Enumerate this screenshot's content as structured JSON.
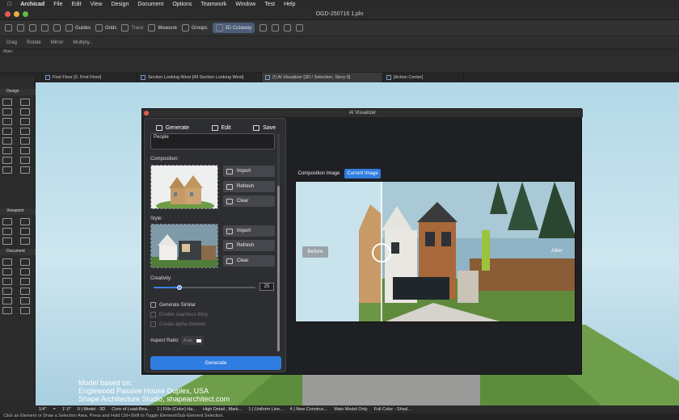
{
  "menubar": {
    "app": "Archicad",
    "items": [
      "File",
      "Edit",
      "View",
      "Design",
      "Document",
      "Options",
      "Teamwork",
      "Window",
      "Test",
      "Help"
    ]
  },
  "window": {
    "title": "OGD-250716 1.pln"
  },
  "toolbar": {
    "guides": "Guides",
    "grids": "Grids",
    "trace": "Trace",
    "measure": "Measure",
    "groups": "Groups",
    "cutaway": "3D Cutaway"
  },
  "edit_toolbar": {
    "drag": "Drag",
    "rotate": "Rotate",
    "mirror": "Mirror",
    "multiply": "Multiply..."
  },
  "main_label": "Main:",
  "tabs": [
    {
      "label": "First Floor [0. First Floor]"
    },
    {
      "label": "Section Looking West [49 Section Looking West]"
    },
    {
      "label": "(!) AI Visualizer [3D / Selection, Story 0]"
    },
    {
      "label": "[Action Center]"
    }
  ],
  "toolbox": {
    "design": "Design",
    "viewpoint": "Viewpoint",
    "document": "Document"
  },
  "ai_window": {
    "title": "AI Visualizer",
    "tabs": {
      "generate": "Generate",
      "edit": "Edit",
      "save": "Save"
    },
    "prompt_text": "People",
    "composition_label": "Composition:",
    "style_label": "Style:",
    "buttons": {
      "import": "Import",
      "refresh": "Refresh",
      "clear": "Clear"
    },
    "creativity_label": "Creativity:",
    "creativity_value": "25",
    "creativity_fraction": 0.25,
    "checkboxes": {
      "generate_similar": "Generate Similar",
      "seamless": "Enable seamless tiling",
      "alpha": "Create alpha channel"
    },
    "aspect_ratio_label": "Aspect Ratio:",
    "aspect_value": "Auto",
    "generate_button": "Generate",
    "seg": {
      "composition": "Composition Image",
      "current": "Current Image"
    },
    "before": "Before",
    "after": "After"
  },
  "credit": {
    "line1": "Model based on:",
    "line2": "Englewood Passive House Duplex, USA",
    "line3": "Shape Architecture Studio, shapearchitect.com"
  },
  "status": {
    "scale": "1/4\"",
    "eq": "=",
    "size": "1'-0\"",
    "model": "0 | Model - 3D",
    "core": "Core of Load-Bea...",
    "fills": "1 | Fills (Color) Ha...",
    "detail": "High Detail , Mark...",
    "uniform": "1 | Uniform Line...",
    "construct": "4 | New Construc...",
    "main_model": "Main Model Only",
    "color": "Full Color - Shad..."
  },
  "hint": "Click an Element or Draw a Selection Area. Press and Hold Ctrl+Shift to Toggle Element/Sub-Element Selection.",
  "colors": {
    "accent": "#2f7de1",
    "close": "#e45b55"
  }
}
